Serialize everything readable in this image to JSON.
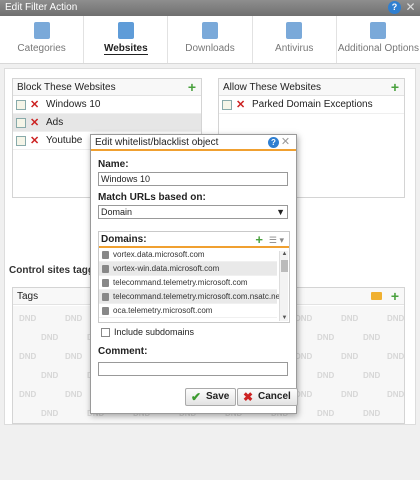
{
  "window": {
    "title": "Edit Filter Action",
    "help_glyph": "?",
    "close_glyph": "✕"
  },
  "tabs": [
    {
      "label": "Categories",
      "icon": "categories-icon"
    },
    {
      "label": "Websites",
      "icon": "websites-icon"
    },
    {
      "label": "Downloads",
      "icon": "download-icon"
    },
    {
      "label": "Antivirus",
      "icon": "antivirus-icon"
    },
    {
      "label": "Additional Options",
      "icon": "options-icon"
    }
  ],
  "block_panel": {
    "title": "Block These Websites",
    "add_glyph": "+",
    "items": [
      {
        "label": "Windows 10"
      },
      {
        "label": "Ads"
      },
      {
        "label": "Youtube"
      }
    ]
  },
  "allow_panel": {
    "title": "Allow These Websites",
    "add_glyph": "+",
    "items": [
      {
        "label": "Parked Domain Exceptions"
      }
    ]
  },
  "control_label": "Control sites tagged",
  "tags_panel": {
    "title": "Tags",
    "add_glyph": "+",
    "watermark": "DND"
  },
  "dialog": {
    "title": "Edit whitelist/blacklist object",
    "help_glyph": "?",
    "close_glyph": "✕",
    "name_label": "Name:",
    "name_value": "Windows 10",
    "match_label": "Match URLs based on:",
    "match_value": "Domain",
    "domains_label": "Domains:",
    "domains_add_glyph": "+",
    "domains_menu_glyph": "☰ ▾",
    "domains": [
      "vortex.data.microsoft.com",
      "vortex-win.data.microsoft.com",
      "telecommand.telemetry.microsoft.com",
      "telecommand.telemetry.microsoft.com.nsatc.net",
      "oca.telemetry.microsoft.com"
    ],
    "include_subdomains_label": "Include subdomains",
    "include_subdomains_checked": false,
    "comment_label": "Comment:",
    "comment_value": "",
    "save_label": "Save",
    "cancel_label": "Cancel"
  },
  "colors": {
    "accent": "#f0a030",
    "add": "#49a13d",
    "delete": "#cc2222",
    "help": "#2f7fd1"
  }
}
